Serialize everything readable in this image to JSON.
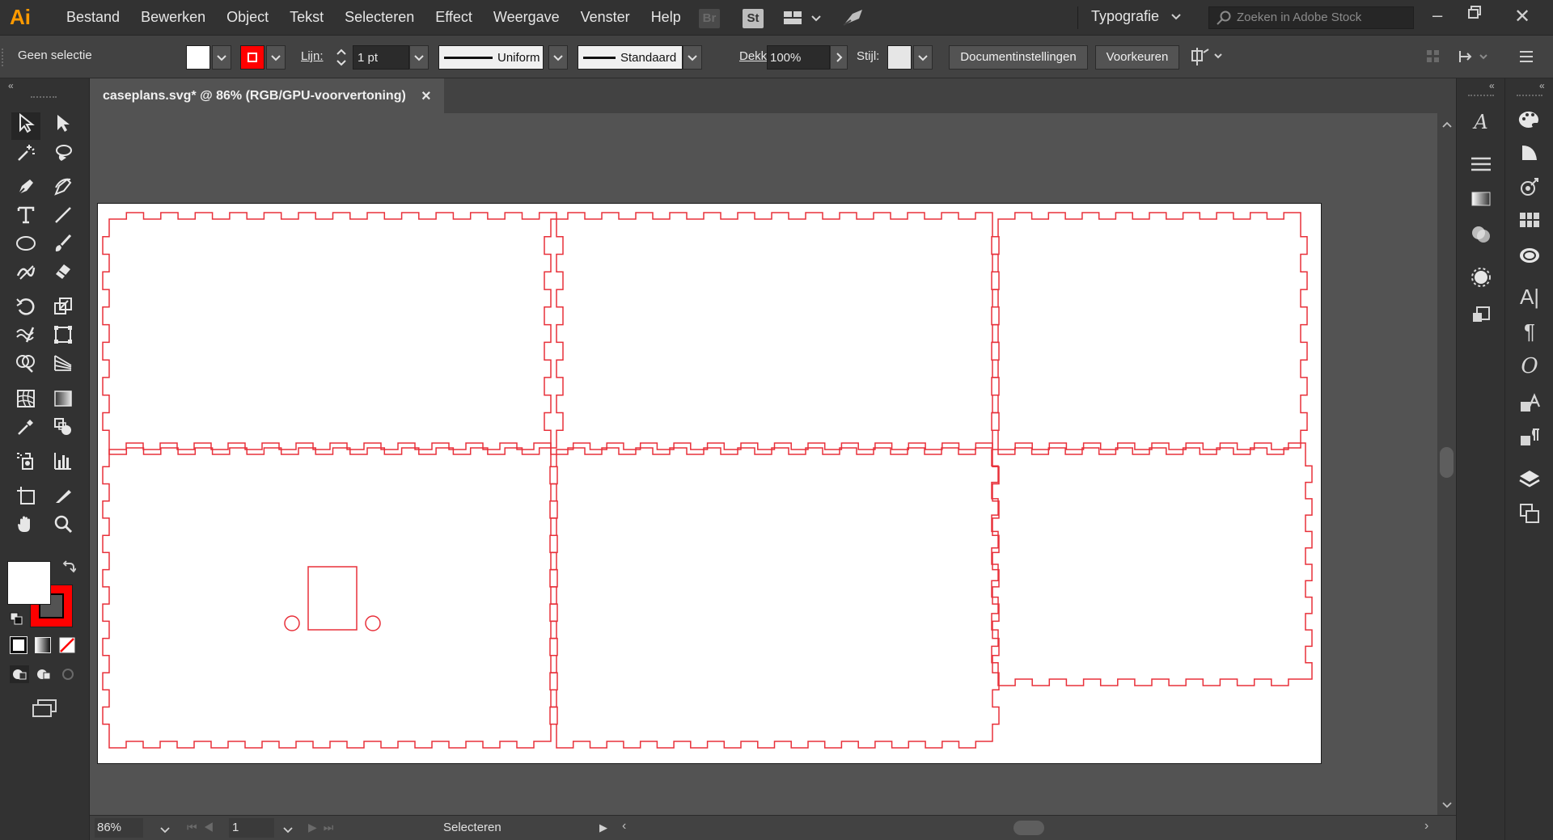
{
  "menubar": {
    "logo": "Ai",
    "items": [
      "Bestand",
      "Bewerken",
      "Object",
      "Tekst",
      "Selecteren",
      "Effect",
      "Weergave",
      "Venster",
      "Help"
    ],
    "bridge": "Br",
    "stock_icon": "St",
    "workspace": "Typografie",
    "search_placeholder": "Zoeken in Adobe Stock"
  },
  "controlbar": {
    "selection": "Geen selectie",
    "stroke_label": "Lijn:",
    "stroke_value": "1 pt",
    "profile": "Uniform",
    "brush": "Standaard",
    "opacity_label": "Dekking:",
    "opacity_value": "100%",
    "style_label": "Stijl:",
    "doc_settings": "Documentinstellingen",
    "preferences": "Voorkeuren"
  },
  "document": {
    "tab_title": "caseplans.svg* @ 86% (RGB/GPU-voorvertoning)",
    "close": "×"
  },
  "statusbar": {
    "zoom": "86%",
    "artboard": "1",
    "status": "Selecteren"
  },
  "colors": {
    "stroke": "#ff0000",
    "fill": "#ffffff",
    "cut_line": "#e8303a"
  },
  "icons": {
    "selection": "selection-tool-icon",
    "direct_selection": "direct-selection-tool-icon",
    "magic_wand": "magic-wand-icon",
    "lasso": "lasso-icon",
    "pen": "pen-tool-icon",
    "type": "type-tool-icon",
    "zoom": "zoom-tool-icon",
    "hand": "hand-tool-icon"
  }
}
